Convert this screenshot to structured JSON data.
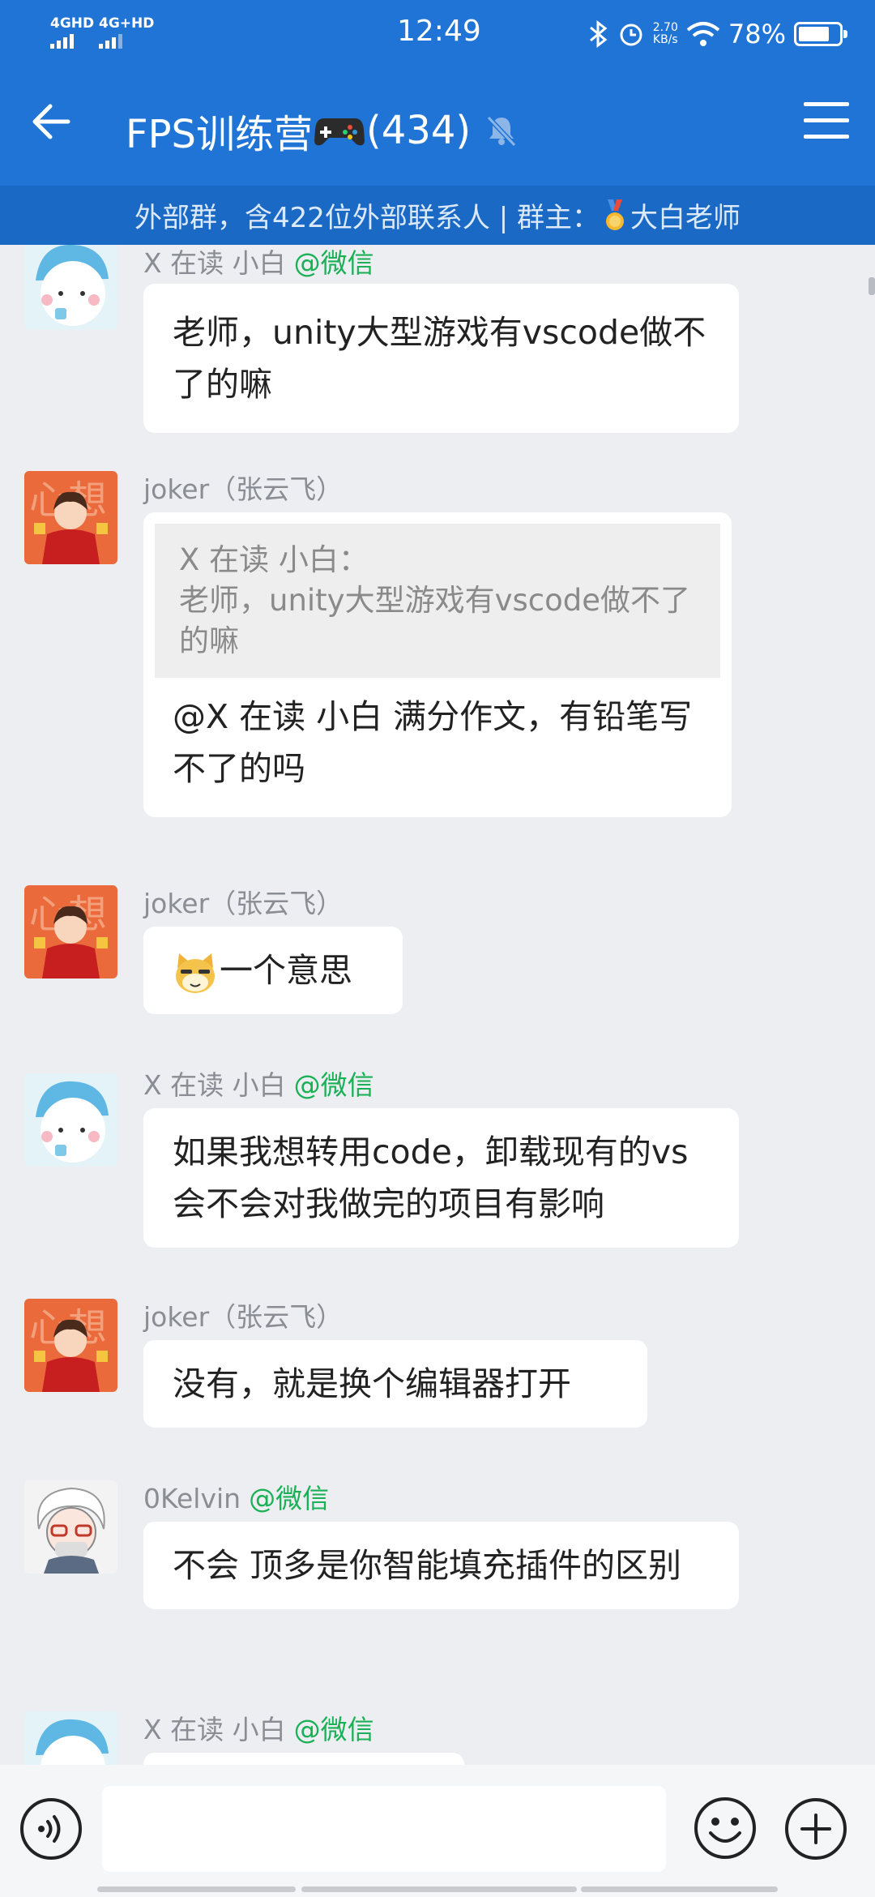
{
  "status_bar": {
    "network1": "4GHD",
    "network2": "4G+HD",
    "time": "12:49",
    "speed_value": "2.70",
    "speed_unit": "KB/s",
    "battery_text": "78%",
    "battery_level": 0.78
  },
  "header": {
    "title_prefix": "FPS训练营",
    "member_count": "(434)",
    "subtitle_main": "外部群，含422位外部联系人 | 群主：",
    "owner_name": "大白老师"
  },
  "colors": {
    "header_bg": "#1f74d6",
    "subtitle_bg": "#1a69c4",
    "wechat_tag": "#1ab055",
    "chat_bg": "#eceef2"
  },
  "messages": [
    {
      "sender": "X 在读 小白",
      "tag": "@微信",
      "avatar": "bear-avatar",
      "text": "老师，unity大型游戏有vscode做不了的嘛"
    },
    {
      "sender": "joker（张云飞）",
      "tag": "",
      "avatar": "joker-avatar",
      "quote_author": "X 在读 小白：",
      "quote_text": "老师，unity大型游戏有vscode做不了的嘛",
      "text": "@X 在读 小白  满分作文，有铅笔写不了的吗"
    },
    {
      "sender": "joker（张云飞）",
      "tag": "",
      "avatar": "joker-avatar",
      "emoji": "doge-cat-emoji",
      "text": "一个意思"
    },
    {
      "sender": "X 在读 小白",
      "tag": "@微信",
      "avatar": "bear-avatar",
      "text": "如果我想转用code，卸载现有的vs会不会对我做完的项目有影响"
    },
    {
      "sender": "joker（张云飞）",
      "tag": "",
      "avatar": "joker-avatar",
      "text": "没有，就是换个编辑器打开"
    },
    {
      "sender": "0Kelvin",
      "tag": "@微信",
      "avatar": "kelvin-avatar",
      "text": "不会 顶多是你智能填充插件的区别"
    },
    {
      "sender": "X 在读 小白",
      "tag": "@微信",
      "avatar": "bear-avatar",
      "text": ""
    }
  ],
  "input": {
    "placeholder": ""
  },
  "icons": [
    "back-arrow-icon",
    "gamepad-icon",
    "mute-bell-icon",
    "menu-icon",
    "medal-icon",
    "voice-icon",
    "emoji-icon",
    "plus-icon"
  ]
}
